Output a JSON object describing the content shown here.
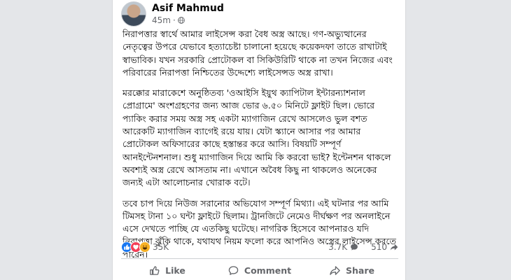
{
  "post": {
    "author": "Asif Mahmud",
    "time": "45m",
    "paragraphs": [
      "নিরাপত্তার স্বার্থে আমার লাইসেন্স করা বৈধ অস্ত্র আছে। গণ-অভ্যুত্থানের নেতৃত্বের উপরে যেভাবে হত্যাচেষ্টা চালানো হয়েছে কয়েকদফা তাতে রাখাটাই স্বাভাবিক। যখন সরকারি প্রোটোকল বা সিকিউরিটি থাকে না তখন নিজের এবং পরিবারের নিরাপত্তা নিশ্চিতের উদ্দেশ্যে লাইসেন্সড অস্ত্র রাখা।",
      "মরক্কোর মারাকেশে অনুষ্ঠিতব্য 'ওআইসি ইয়ুথ ক্যাপিটাল ইন্টারন্যাশনাল প্রোগ্রামে' অংশগ্রহণের জন্য আজ ভোর ৬.৫০ মিনিটে ফ্লাইট ছিল। ভোরে প্যাকিং করার সময় অস্ত্র সহ একটা ম্যাগাজিন রেখে আসলেও ভুল বশত আরেকটি ম্যাগাজিন ব্যাগেই রয়ে যায়। যেটা স্ক্যানে আসার পর আমার প্রোটোকল অফিসারের কাছে হস্তান্তর করে আসি। বিষয়টি সম্পূর্ণ আনইন্টেনশনাল। শুধু ম্যাগাজিন দিয়ে আমি কি করবো ভাই? ইন্টেনশন থাকলে অবশ্যই অস্ত্র রেখে আসতাম না। এখানে অবৈধ কিছু না থাকলেও অনেকের জন্যই এটা আলোচনার খোরাক বটে।",
      "তবে চাপ দিয়ে নিউজ সরানোর অভিযোগ সম্পূর্ণ মিথ্যা। এই ঘটনার পর আমি টিমসহ টানা ১০ ঘন্টা ফ্লাইটে ছিলাম। ট্রানজিটে নেমেও দীর্ঘক্ষণ পর অনলাইনে এসে দেখতে পাচ্ছি যে এতকিছু ঘটেছে। নাগরিক হিসেবে আপনারও যদি নিরাপত্তা ঝুঁকি থাকে, যথাযথ নিয়ম ফলো করে আপনিও অস্ত্রের লাইসেন্স করতে পারেন।"
    ]
  },
  "engagement": {
    "reactions_count": "35K",
    "comments_count": "3.7K",
    "shares_count": "510"
  },
  "actions": {
    "like": "Like",
    "comment": "Comment",
    "share": "Share"
  },
  "colors": {
    "like_blue": "#1877f2",
    "love_red": "#f33e58",
    "haha_yellow": "#f7b125",
    "muted_text": "#65676b"
  },
  "icons": [
    "globe-icon",
    "like-reaction-icon",
    "love-reaction-icon",
    "haha-reaction-icon",
    "comment-icon",
    "share-icon",
    "thumbs-up-icon",
    "comment-bubble-icon",
    "share-arrow-icon"
  ]
}
